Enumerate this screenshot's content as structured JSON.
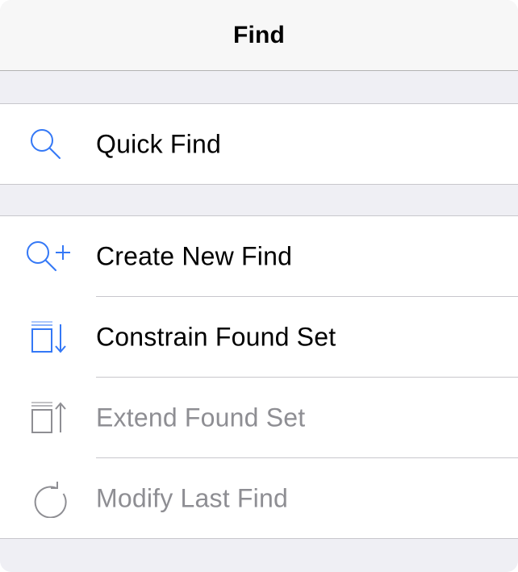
{
  "header": {
    "title": "Find"
  },
  "colors": {
    "accent": "#3478f6",
    "disabled": "#8e8e93",
    "background": "#efeff4",
    "separator": "#c8c7cc"
  },
  "quick_section": {
    "items": [
      {
        "label": "Quick Find",
        "icon": "magnifier-icon",
        "enabled": true
      }
    ]
  },
  "find_section": {
    "items": [
      {
        "label": "Create New Find",
        "icon": "magnifier-plus-icon",
        "enabled": true
      },
      {
        "label": "Constrain Found Set",
        "icon": "constrain-found-set-icon",
        "enabled": true
      },
      {
        "label": "Extend Found Set",
        "icon": "extend-found-set-icon",
        "enabled": false
      },
      {
        "label": "Modify Last Find",
        "icon": "refresh-icon",
        "enabled": false
      }
    ]
  }
}
